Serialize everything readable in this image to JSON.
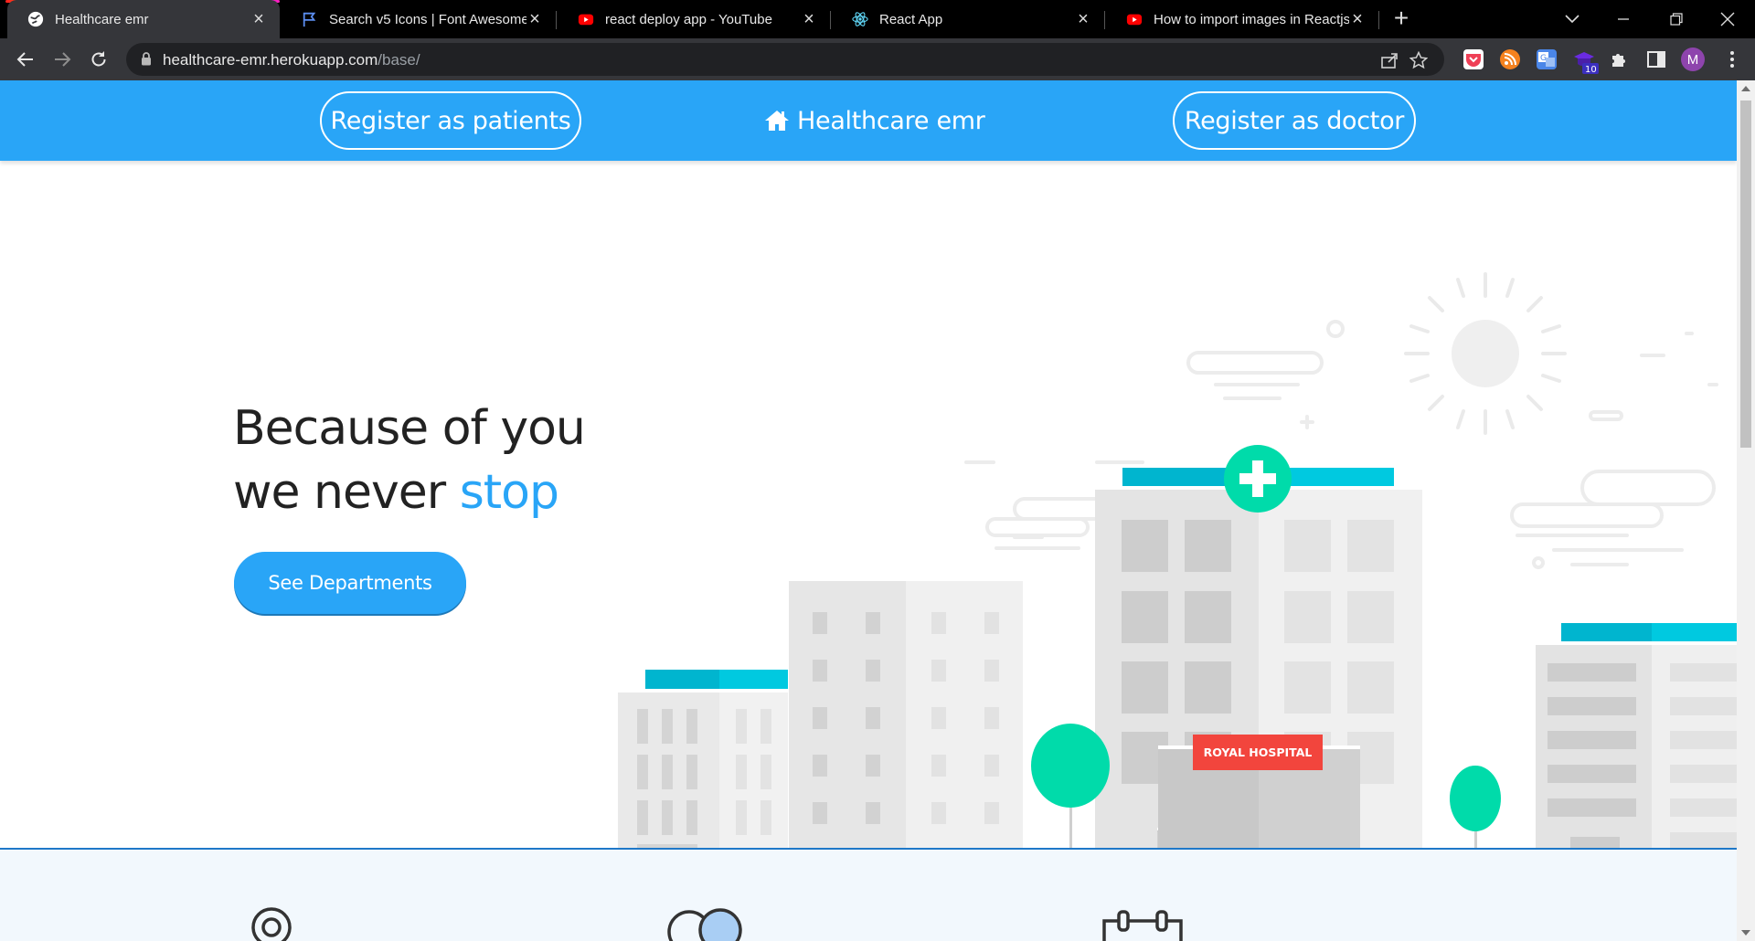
{
  "browser": {
    "tabs": [
      {
        "title": "Healthcare emr",
        "favicon": "globe-icon",
        "active": true
      },
      {
        "title": "Search v5 Icons | Font Awesome",
        "favicon": "flag-icon",
        "active": false
      },
      {
        "title": "react deploy app - YouTube",
        "favicon": "youtube-icon",
        "active": false
      },
      {
        "title": "React App",
        "favicon": "react-icon",
        "active": false
      },
      {
        "title": "How to import images in Reactjs",
        "favicon": "youtube-icon",
        "active": false
      }
    ],
    "url_host": "healthcare-emr.herokuapp.com",
    "url_path": "/base/",
    "profile_initial": "M",
    "extension_badge": "10"
  },
  "navbar": {
    "register_patients": "Register as patients",
    "brand": "Healthcare emr",
    "register_doctor": "Register as doctor"
  },
  "hero": {
    "line1": "Because of you",
    "line2_prefix": "we never ",
    "line2_accent": "stop",
    "cta": "See Departments",
    "sign": "ROYAL HOSPITAL"
  },
  "colors": {
    "primary": "#29a5f7",
    "teal": "#00c2d6",
    "mint": "#00dbaa",
    "sign_red": "#f2453d"
  }
}
